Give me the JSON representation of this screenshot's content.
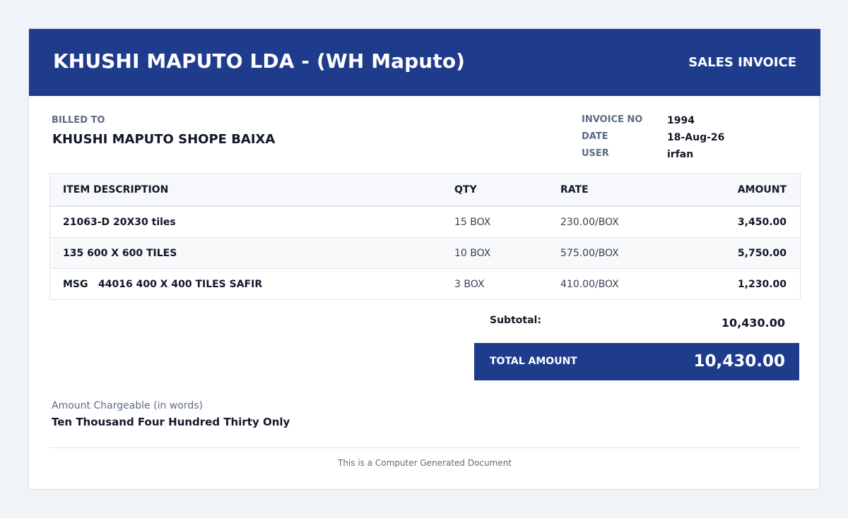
{
  "header": {
    "company": "KHUSHI MAPUTO LDA - (WH Maputo)",
    "doc_type": "SALES INVOICE"
  },
  "billing": {
    "label": "BILLED TO",
    "name": "KHUSHI MAPUTO SHOPE BAIXA"
  },
  "meta": {
    "invoice_no_label": "INVOICE NO",
    "invoice_no": "1994",
    "date_label": "DATE",
    "date": "18-Aug-26",
    "user_label": "USER",
    "user": "irfan"
  },
  "table": {
    "headers": {
      "description": "ITEM DESCRIPTION",
      "qty": "QTY",
      "rate": "RATE",
      "amount": "AMOUNT"
    },
    "rows": [
      {
        "description": "21063-D 20X30 tiles",
        "qty": "15 BOX",
        "rate": "230.00/BOX",
        "amount": "3,450.00"
      },
      {
        "description": "135 600 X 600 TILES",
        "qty": "10 BOX",
        "rate": "575.00/BOX",
        "amount": "5,750.00"
      },
      {
        "code": "MSG",
        "description": "44016 400 X 400 TILES SAFIR",
        "qty": "3 BOX",
        "rate": "410.00/BOX",
        "amount": "1,230.00"
      }
    ]
  },
  "totals": {
    "subtotal_label": "Subtotal:",
    "subtotal": "10,430.00",
    "total_label": "TOTAL AMOUNT",
    "total": "10,430.00"
  },
  "words": {
    "label": "Amount Chargeable (in words)",
    "value": "Ten Thousand Four Hundred Thirty Only"
  },
  "footer": {
    "text": "This is a Computer Generated Document"
  },
  "colors": {
    "brand": "#1f3c8c",
    "muted": "#5b6b84",
    "text": "#111827"
  }
}
